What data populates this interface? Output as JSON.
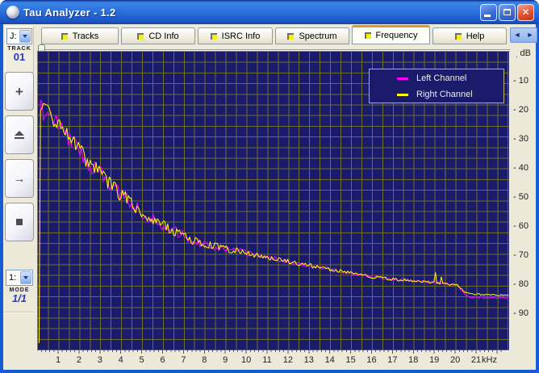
{
  "window": {
    "title": "Tau Analyzer - 1.2",
    "controls": {
      "minimize": "minimize",
      "maximize": "maximize",
      "close": "close"
    }
  },
  "tabs": [
    {
      "label": "Tracks",
      "active": false
    },
    {
      "label": "CD Info",
      "active": false
    },
    {
      "label": "ISRC Info",
      "active": false
    },
    {
      "label": "Spectrum",
      "active": false
    },
    {
      "label": "Frequency",
      "active": true
    },
    {
      "label": "Help",
      "active": false
    }
  ],
  "tab_scroll": {
    "left": "◄",
    "right": "►"
  },
  "sidebar": {
    "drive_label": "J:",
    "track_label": "TRACK",
    "track_value": "01",
    "mode_select_label": "1:",
    "mode_label": "MODE",
    "mode_value": "1/1",
    "buttons": [
      {
        "name": "add",
        "glyph": "plus"
      },
      {
        "name": "eject",
        "glyph": "eject"
      },
      {
        "name": "next",
        "glyph": "arrow"
      },
      {
        "name": "stop",
        "glyph": "stop"
      }
    ]
  },
  "chart_data": {
    "type": "line",
    "title": "",
    "xlabel": "kHz",
    "ylabel": "dB",
    "x_ticks": [
      1,
      2,
      3,
      4,
      5,
      6,
      7,
      8,
      9,
      10,
      11,
      12,
      13,
      14,
      15,
      16,
      17,
      18,
      19,
      20,
      21
    ],
    "y_ticks": [
      10,
      20,
      30,
      40,
      50,
      60,
      70,
      80,
      90
    ],
    "x_range_khz": [
      0,
      22.55
    ],
    "y_range_db": [
      0,
      102
    ],
    "y_axis_inverted_down": true,
    "grid": true,
    "legend_position": "top-right",
    "legend": [
      {
        "name": "Left Channel",
        "color": "#ff00ff"
      },
      {
        "name": "Right Channel",
        "color": "#ffff00"
      }
    ],
    "sample_step_khz": 0.07,
    "noise_profile_khz_amp_db": [
      [
        0.1,
        3.2
      ],
      [
        1,
        3.2
      ],
      [
        2,
        3.0
      ],
      [
        3,
        2.8
      ],
      [
        4,
        2.5
      ],
      [
        5,
        2.2
      ],
      [
        6,
        1.9
      ],
      [
        7,
        1.6
      ],
      [
        8,
        1.4
      ],
      [
        9,
        1.2
      ],
      [
        10,
        1.0
      ],
      [
        12,
        0.8
      ],
      [
        14,
        0.65
      ],
      [
        16,
        0.5
      ],
      [
        18,
        0.45
      ],
      [
        20,
        0.35
      ],
      [
        22.55,
        0.25
      ]
    ],
    "series": [
      {
        "name": "Left Channel",
        "color": "#ff00ff",
        "anchors_khz_db": [
          [
            0.05,
            100
          ],
          [
            0.1,
            19.5
          ],
          [
            0.3,
            20.5
          ],
          [
            0.6,
            22
          ],
          [
            1,
            25
          ],
          [
            1.4,
            28.5
          ],
          [
            1.8,
            32
          ],
          [
            2.2,
            36
          ],
          [
            2.6,
            39.5
          ],
          [
            3,
            42
          ],
          [
            3.5,
            45.5
          ],
          [
            4,
            49
          ],
          [
            4.5,
            52
          ],
          [
            5,
            55
          ],
          [
            5.5,
            57.5
          ],
          [
            6,
            59.5
          ],
          [
            6.5,
            61.5
          ],
          [
            7,
            63
          ],
          [
            7.5,
            65
          ],
          [
            8,
            66
          ],
          [
            9,
            67.5
          ],
          [
            10,
            69
          ],
          [
            11,
            70.5
          ],
          [
            12,
            72
          ],
          [
            13,
            73.3
          ],
          [
            14,
            74.6
          ],
          [
            15,
            76
          ],
          [
            16,
            77.2
          ],
          [
            17,
            78
          ],
          [
            18,
            78.6
          ],
          [
            19,
            79.2
          ],
          [
            19.8,
            79.8
          ],
          [
            20.1,
            80.2
          ],
          [
            20.45,
            83.5
          ],
          [
            20.7,
            84.3
          ],
          [
            22.55,
            84.5
          ]
        ],
        "spikes_khz_db": []
      },
      {
        "name": "Right Channel",
        "color": "#ffff00",
        "anchors_khz_db": [
          [
            0.05,
            100
          ],
          [
            0.1,
            19.5
          ],
          [
            0.3,
            20.5
          ],
          [
            0.6,
            22
          ],
          [
            1,
            25
          ],
          [
            1.4,
            28.5
          ],
          [
            1.8,
            32
          ],
          [
            2.2,
            36
          ],
          [
            2.6,
            39.5
          ],
          [
            3,
            42
          ],
          [
            3.5,
            45.5
          ],
          [
            4,
            49
          ],
          [
            4.5,
            52
          ],
          [
            5,
            55
          ],
          [
            5.5,
            57.5
          ],
          [
            6,
            59.5
          ],
          [
            6.5,
            61.5
          ],
          [
            7,
            63
          ],
          [
            7.5,
            65
          ],
          [
            8,
            66
          ],
          [
            9,
            67.5
          ],
          [
            10,
            69
          ],
          [
            11,
            70.5
          ],
          [
            12,
            72
          ],
          [
            13,
            73.3
          ],
          [
            14,
            74.6
          ],
          [
            15,
            76
          ],
          [
            16,
            77.2
          ],
          [
            17,
            78
          ],
          [
            18,
            78.6
          ],
          [
            19,
            79.2
          ],
          [
            19.8,
            79.8
          ],
          [
            20.1,
            80.2
          ],
          [
            20.45,
            82.5
          ],
          [
            20.7,
            83.2
          ],
          [
            22.55,
            83.5
          ]
        ],
        "spikes_khz_db": [
          [
            19.0,
            3.2
          ],
          [
            19.3,
            2.2
          ]
        ]
      }
    ]
  },
  "colors": {
    "plot_background": "#1b1b6b",
    "grid": "#6f6f2d",
    "left_channel": "#ff00ff",
    "right_channel": "#ffff00",
    "titlebar_blue": "#2e74de",
    "client_beige": "#ece9d8",
    "active_tab_orange": "#e5932c",
    "value_blue": "#2a3cc0"
  }
}
